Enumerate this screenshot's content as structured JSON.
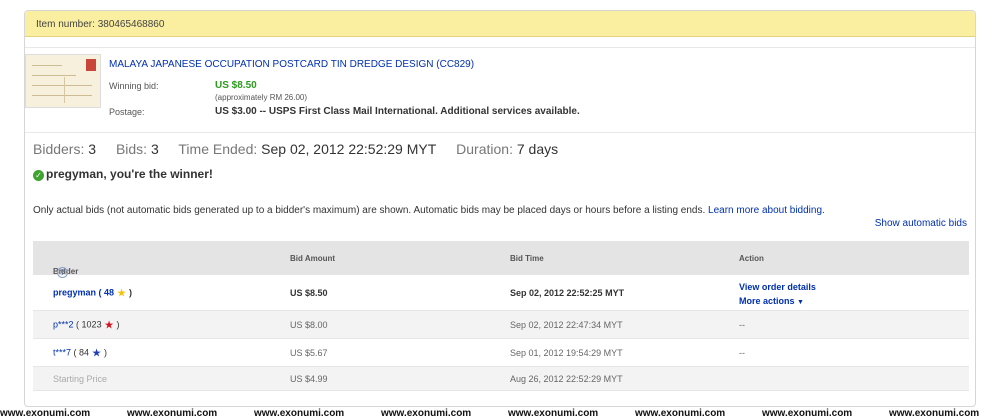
{
  "item_bar": {
    "label": "Item number: 380465468860"
  },
  "item": {
    "title": "MALAYA JAPANESE OCCUPATION POSTCARD TIN DREDGE DESIGN (CC829)",
    "winning_bid_label": "Winning bid:",
    "winning_bid_value": "US $8.50",
    "winning_bid_approx": "(approximately RM 26.00)",
    "postage_label": "Postage:",
    "postage_value": "US $3.00 -- USPS First Class Mail International.  Additional services available."
  },
  "stats": {
    "bidders_label": "Bidders:",
    "bidders_value": "3",
    "bids_label": "Bids:",
    "bids_value": "3",
    "time_ended_label": "Time Ended:",
    "time_ended_value": "Sep 02, 2012 22:52:29 MYT",
    "duration_label": "Duration:",
    "duration_value": "7 days"
  },
  "winner_message": "pregyman, you're the winner!",
  "notice": {
    "text": "Only actual bids (not automatic bids generated up to a bidder's maximum) are shown. Automatic bids may be placed days or hours before a listing ends. ",
    "link": "Learn more about bidding."
  },
  "show_automatic_bids": "Show automatic bids",
  "table": {
    "headers": [
      "Bidder",
      "Bid Amount",
      "Bid Time",
      "Action"
    ],
    "rows": [
      {
        "bidder": "pregyman",
        "score": "48",
        "amount": "US $8.50",
        "time": "Sep 02, 2012 22:52:25 MYT",
        "action1": "View order details",
        "action2": "More actions"
      },
      {
        "bidder": "p***2",
        "score": "1023",
        "amount": "US $8.00",
        "time": "Sep 02, 2012 22:47:34 MYT",
        "action": "--"
      },
      {
        "bidder": "t***7",
        "score": "84",
        "amount": "US $5.67",
        "time": "Sep 01, 2012 19:54:29 MYT",
        "action": "--"
      },
      {
        "bidder": "Starting Price",
        "amount": "US $4.99",
        "time": "Aug 26, 2012 22:52:29 MYT"
      }
    ]
  },
  "star_colors": {
    "yellow": "#f4c20d",
    "red": "#d4151d",
    "blue": "#1f3fb8"
  },
  "footer": {
    "watermark": "www.exonumi.com"
  }
}
